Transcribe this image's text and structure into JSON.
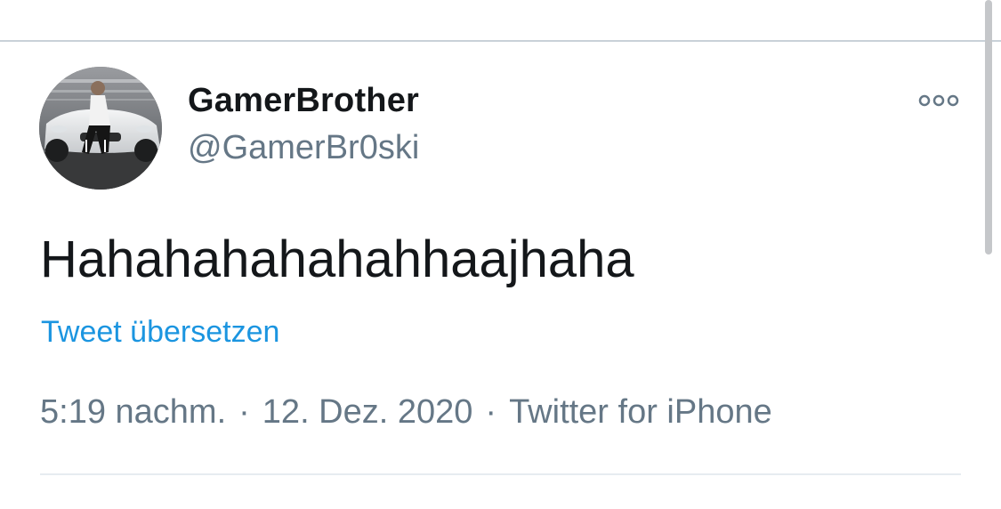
{
  "tweet": {
    "display_name": "GamerBrother",
    "handle": "@GamerBr0ski",
    "text": "Hahahahahahahhaajhaha",
    "translate_label": "Tweet übersetzen",
    "time": "5:19 nachm.",
    "separator": "·",
    "date": "12. Dez. 2020",
    "source": "Twitter for iPhone",
    "avatar_icon": "user-avatar-photo",
    "more_icon": "more-options-icon"
  },
  "colors": {
    "primary_text": "#14171a",
    "secondary_text": "#657786",
    "link": "#1b95e0",
    "divider": "#e6ecf0"
  }
}
